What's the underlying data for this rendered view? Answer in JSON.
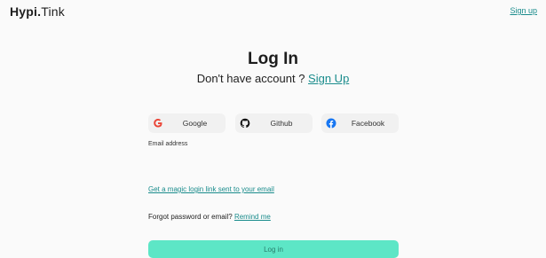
{
  "header": {
    "brand_bold": "Hypi.",
    "brand_rest": "Tink",
    "signup_link": "Sign up"
  },
  "main": {
    "title": "Log In",
    "subtitle_text": "Don't have account ? ",
    "subtitle_link": "Sign Up",
    "social": [
      {
        "label": "Google",
        "icon": "google-icon"
      },
      {
        "label": "Github",
        "icon": "github-icon"
      },
      {
        "label": "Facebook",
        "icon": "facebook-icon"
      }
    ],
    "email_label": "Email address",
    "email_value": "",
    "magic_link": "Get a magic login link sent to your email",
    "forgot_text": "Forgot password or email? ",
    "remind_link": "Remind me",
    "login_button": "Log in"
  },
  "colors": {
    "accent": "#1a8c8c",
    "button": "#5de6c6",
    "google_red": "#ea4335",
    "facebook_blue": "#1877f2"
  }
}
